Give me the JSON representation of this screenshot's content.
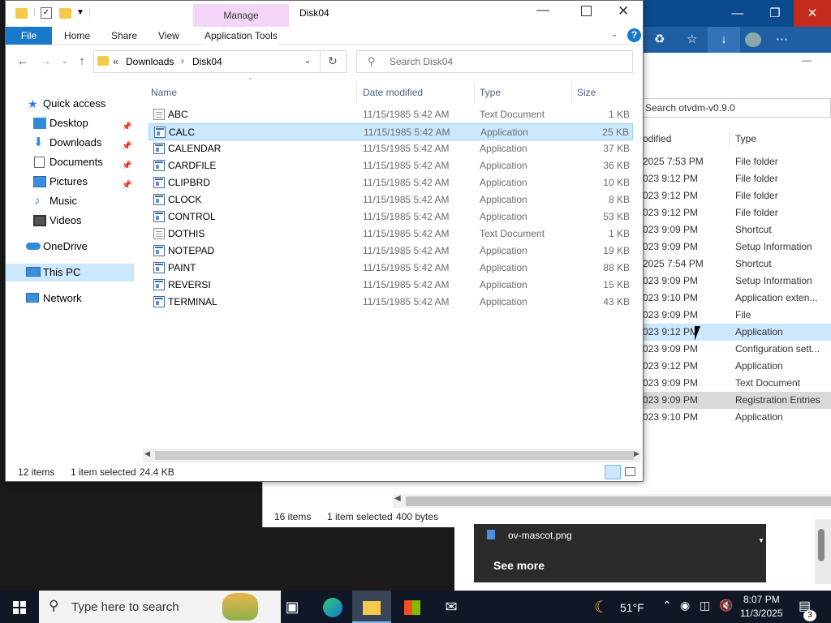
{
  "background_window": {
    "search_placeholder": "Search otvdm-v0.9.0",
    "col_modified": "odified",
    "col_type": "Type",
    "rows": [
      {
        "date": "2025 7:53 PM",
        "type": "File folder"
      },
      {
        "date": "023 9:12 PM",
        "type": "File folder"
      },
      {
        "date": "023 9:12 PM",
        "type": "File folder"
      },
      {
        "date": "023 9:12 PM",
        "type": "File folder"
      },
      {
        "date": "023 9:09 PM",
        "type": "Shortcut"
      },
      {
        "date": "023 9:09 PM",
        "type": "Setup Information"
      },
      {
        "date": "2025 7:54 PM",
        "type": "Shortcut"
      },
      {
        "date": "023 9:09 PM",
        "type": "Setup Information"
      },
      {
        "date": "023 9:10 PM",
        "type": "Application exten..."
      },
      {
        "date": "023 9:09 PM",
        "type": "File"
      },
      {
        "date": "023 9:12 PM",
        "type": "Application"
      },
      {
        "date": "023 9:09 PM",
        "type": "Configuration sett..."
      },
      {
        "date": "023 9:12 PM",
        "type": "Application"
      },
      {
        "date": "023 9:09 PM",
        "type": "Text Document"
      },
      {
        "date": "023 9:09 PM",
        "type": "Registration Entries"
      },
      {
        "date": "023 9:10 PM",
        "type": "Application"
      }
    ],
    "status_items": "16 items",
    "status_selected": "1 item selected",
    "status_size": "400 bytes"
  },
  "notification": {
    "file": "ov-mascot.png",
    "see_more": "See more"
  },
  "window": {
    "title": "Disk04",
    "context_tab": "Manage",
    "ribbon_tabs": {
      "file": "File",
      "home": "Home",
      "share": "Share",
      "view": "View",
      "app_tools": "Application Tools"
    },
    "breadcrumb": {
      "prefix": "«",
      "part1": "Downloads",
      "sep": "›",
      "part2": "Disk04"
    },
    "search_placeholder": "Search Disk04",
    "columns": {
      "name": "Name",
      "date": "Date modified",
      "type": "Type",
      "size": "Size"
    },
    "nav": {
      "quick_access": "Quick access",
      "desktop": "Desktop",
      "downloads": "Downloads",
      "documents": "Documents",
      "pictures": "Pictures",
      "music": "Music",
      "videos": "Videos",
      "onedrive": "OneDrive",
      "thispc": "This PC",
      "network": "Network"
    },
    "files": [
      {
        "name": "ABC",
        "date": "11/15/1985 5:42 AM",
        "type": "Text Document",
        "size": "1 KB",
        "icon": "text-file"
      },
      {
        "name": "CALC",
        "date": "11/15/1985 5:42 AM",
        "type": "Application",
        "size": "25 KB",
        "icon": "application"
      },
      {
        "name": "CALENDAR",
        "date": "11/15/1985 5:42 AM",
        "type": "Application",
        "size": "37 KB",
        "icon": "application"
      },
      {
        "name": "CARDFILE",
        "date": "11/15/1985 5:42 AM",
        "type": "Application",
        "size": "36 KB",
        "icon": "application"
      },
      {
        "name": "CLIPBRD",
        "date": "11/15/1985 5:42 AM",
        "type": "Application",
        "size": "10 KB",
        "icon": "application"
      },
      {
        "name": "CLOCK",
        "date": "11/15/1985 5:42 AM",
        "type": "Application",
        "size": "8 KB",
        "icon": "application"
      },
      {
        "name": "CONTROL",
        "date": "11/15/1985 5:42 AM",
        "type": "Application",
        "size": "53 KB",
        "icon": "application"
      },
      {
        "name": "DOTHIS",
        "date": "11/15/1985 5:42 AM",
        "type": "Text Document",
        "size": "1 KB",
        "icon": "text-file"
      },
      {
        "name": "NOTEPAD",
        "date": "11/15/1985 5:42 AM",
        "type": "Application",
        "size": "19 KB",
        "icon": "application"
      },
      {
        "name": "PAINT",
        "date": "11/15/1985 5:42 AM",
        "type": "Application",
        "size": "88 KB",
        "icon": "application"
      },
      {
        "name": "REVERSI",
        "date": "11/15/1985 5:42 AM",
        "type": "Application",
        "size": "15 KB",
        "icon": "application"
      },
      {
        "name": "TERMINAL",
        "date": "11/15/1985 5:42 AM",
        "type": "Application",
        "size": "43 KB",
        "icon": "application"
      }
    ],
    "selected_file": "CALC",
    "status_items": "12 items",
    "status_selected": "1 item selected",
    "status_size": "24.4 KB"
  },
  "taskbar": {
    "search_placeholder": "Type here to search",
    "weather_temp": "51°F",
    "time": "8:07 PM",
    "date": "11/3/2025",
    "notification_count": "3"
  },
  "colors": {
    "accent": "#1979ca",
    "selection": "#cce8ff",
    "manage_tab": "#f3d5f7",
    "taskbar": "#101727"
  }
}
